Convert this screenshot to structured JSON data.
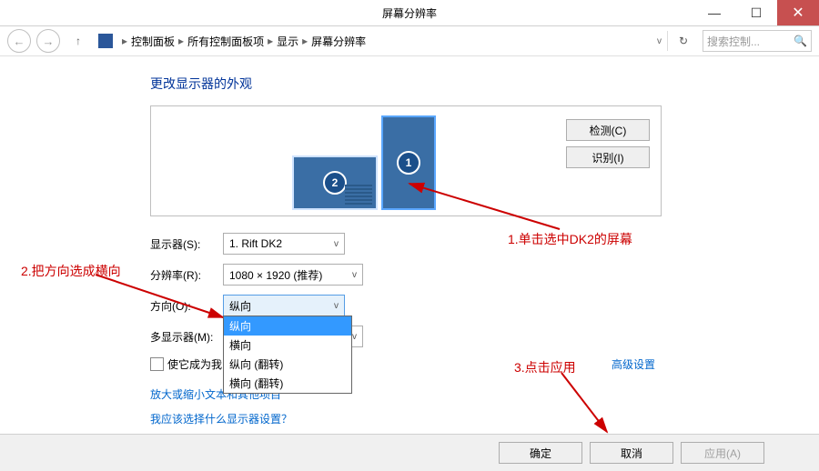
{
  "window": {
    "title": "屏幕分辨率"
  },
  "breadcrumb": {
    "items": [
      "控制面板",
      "所有控制面板项",
      "显示",
      "屏幕分辨率"
    ]
  },
  "search": {
    "placeholder": "搜索控制..."
  },
  "page": {
    "heading": "更改显示器的外观"
  },
  "preview": {
    "monitor1_num": "1",
    "monitor2_num": "2",
    "detect": "检测(C)",
    "identify": "识别(I)"
  },
  "form": {
    "display_label": "显示器(S):",
    "display_value": "1. Rift DK2",
    "resolution_label": "分辨率(R):",
    "resolution_value": "1080 × 1920 (推荐)",
    "orientation_label": "方向(O):",
    "orientation_value": "纵向",
    "orientation_options": [
      "纵向",
      "横向",
      "纵向 (翻转)",
      "横向 (翻转)"
    ],
    "multimon_label": "多显示器(M):",
    "primary_checkbox": "使它成为我的主显示器(K)"
  },
  "links": {
    "textsize": "放大或缩小文本和其他项目",
    "whichdisplay": "我应该选择什么显示器设置？",
    "advanced": "高级设置"
  },
  "buttons": {
    "ok": "确定",
    "cancel": "取消",
    "apply": "应用(A)"
  },
  "annotations": {
    "a1": "1.单击选中DK2的屏幕",
    "a2": "2.把方向选成横向",
    "a3": "3.点击应用"
  }
}
